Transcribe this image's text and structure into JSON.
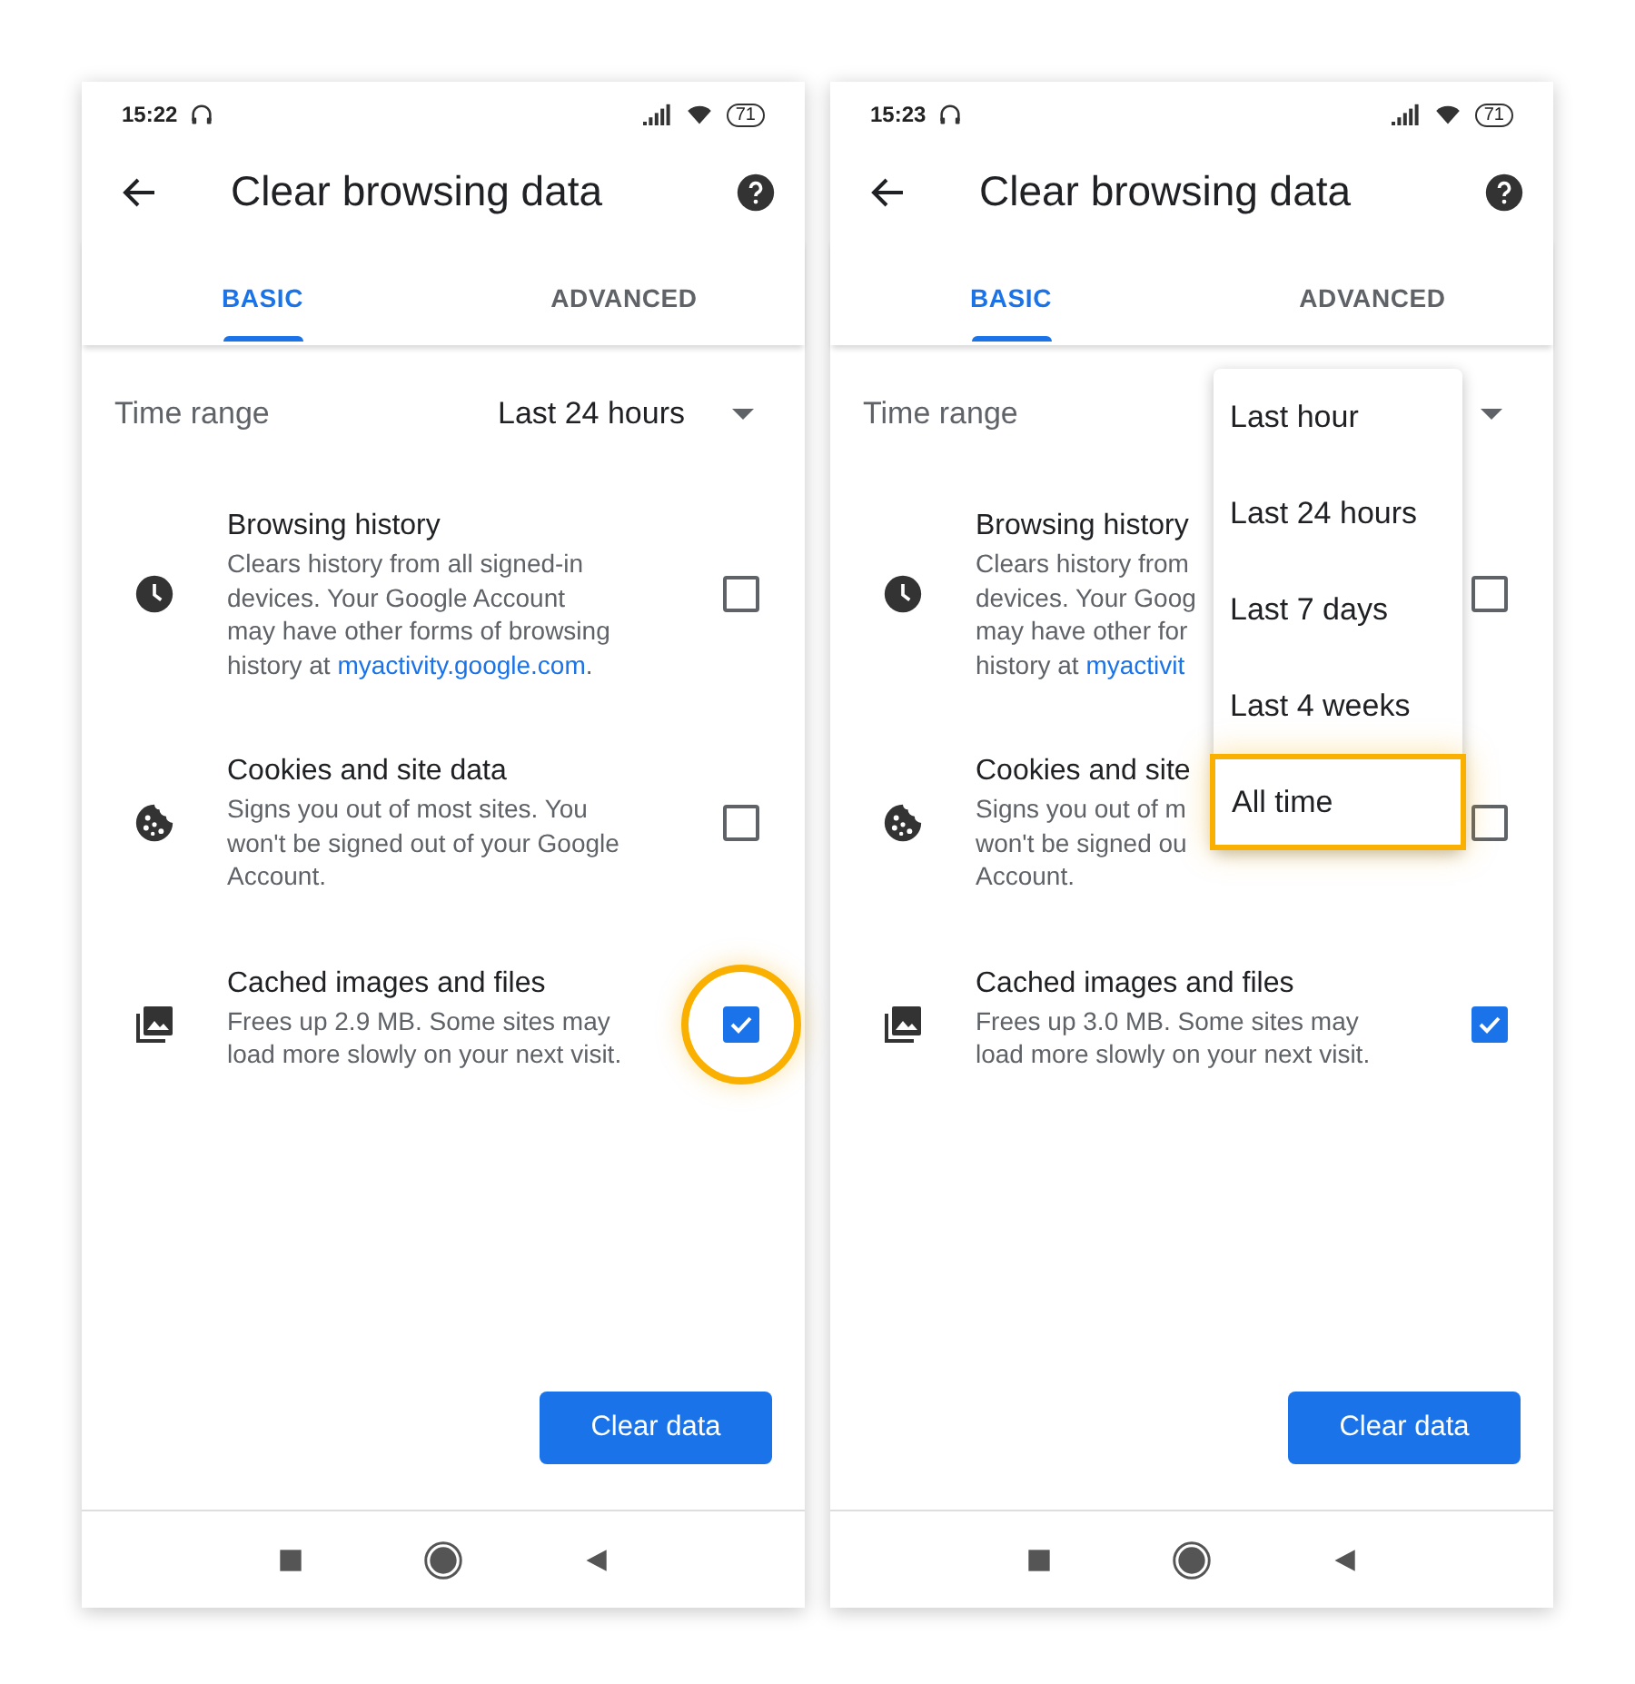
{
  "panels": [
    {
      "status_bar": {
        "time": "15:22",
        "battery": "71"
      },
      "title": "Clear browsing data",
      "tabs": [
        {
          "label": "BASIC",
          "selected": true
        },
        {
          "label": "ADVANCED",
          "selected": false
        }
      ],
      "time_range": {
        "label": "Time range",
        "value": "Last 24 hours"
      },
      "options": [
        {
          "kind": "history",
          "title": "Browsing history",
          "lines": [
            {
              "text": "Clears history from all signed-in"
            },
            {
              "text": "devices. Your Google Account"
            },
            {
              "text": "may have other forms of browsing"
            },
            {
              "text": "history at ",
              "link": "myactivity.google.com",
              "after": "."
            }
          ],
          "checked": false,
          "highlighted": false
        },
        {
          "kind": "cookies",
          "title": "Cookies and site data",
          "lines": [
            {
              "text": "Signs you out of most sites. You"
            },
            {
              "text": "won't be signed out of your Google"
            },
            {
              "text": "Account."
            }
          ],
          "checked": false,
          "highlighted": false
        },
        {
          "kind": "cache",
          "title": "Cached images and files",
          "lines": [
            {
              "text": "Frees up 2.9 MB. Some sites may"
            },
            {
              "text": "load more slowly on your next visit."
            }
          ],
          "checked": true,
          "highlighted": true
        }
      ],
      "button": "Clear data"
    },
    {
      "status_bar": {
        "time": "15:23",
        "battery": "71"
      },
      "title": "Clear browsing data",
      "tabs": [
        {
          "label": "BASIC",
          "selected": true
        },
        {
          "label": "ADVANCED",
          "selected": false
        }
      ],
      "time_range": {
        "label": "Time range"
      },
      "options": [
        {
          "kind": "history",
          "title": "Browsing history",
          "lines": [
            {
              "text": "Clears history from"
            },
            {
              "text": "devices. Your Goog"
            },
            {
              "text": "may have other for"
            },
            {
              "text": "history at ",
              "link": "myactivit"
            }
          ],
          "checked": false,
          "highlighted": false
        },
        {
          "kind": "cookies",
          "title": "Cookies and site",
          "lines": [
            {
              "text": "Signs you out of m"
            },
            {
              "text": "won't be signed ou"
            },
            {
              "text": "Account."
            }
          ],
          "checked": false,
          "highlighted": false
        },
        {
          "kind": "cache",
          "title": "Cached images and files",
          "lines": [
            {
              "text": "Frees up 3.0 MB. Some sites may"
            },
            {
              "text": "load more slowly on your next visit."
            }
          ],
          "checked": true,
          "highlighted": false
        }
      ],
      "button": "Clear data",
      "menu": [
        {
          "label": "Last hour",
          "highlighted": false
        },
        {
          "label": "Last 24 hours",
          "highlighted": false
        },
        {
          "label": "Last 7 days",
          "highlighted": false
        },
        {
          "label": "Last 4 weeks",
          "highlighted": false
        },
        {
          "label": "All time",
          "highlighted": true
        }
      ]
    }
  ]
}
